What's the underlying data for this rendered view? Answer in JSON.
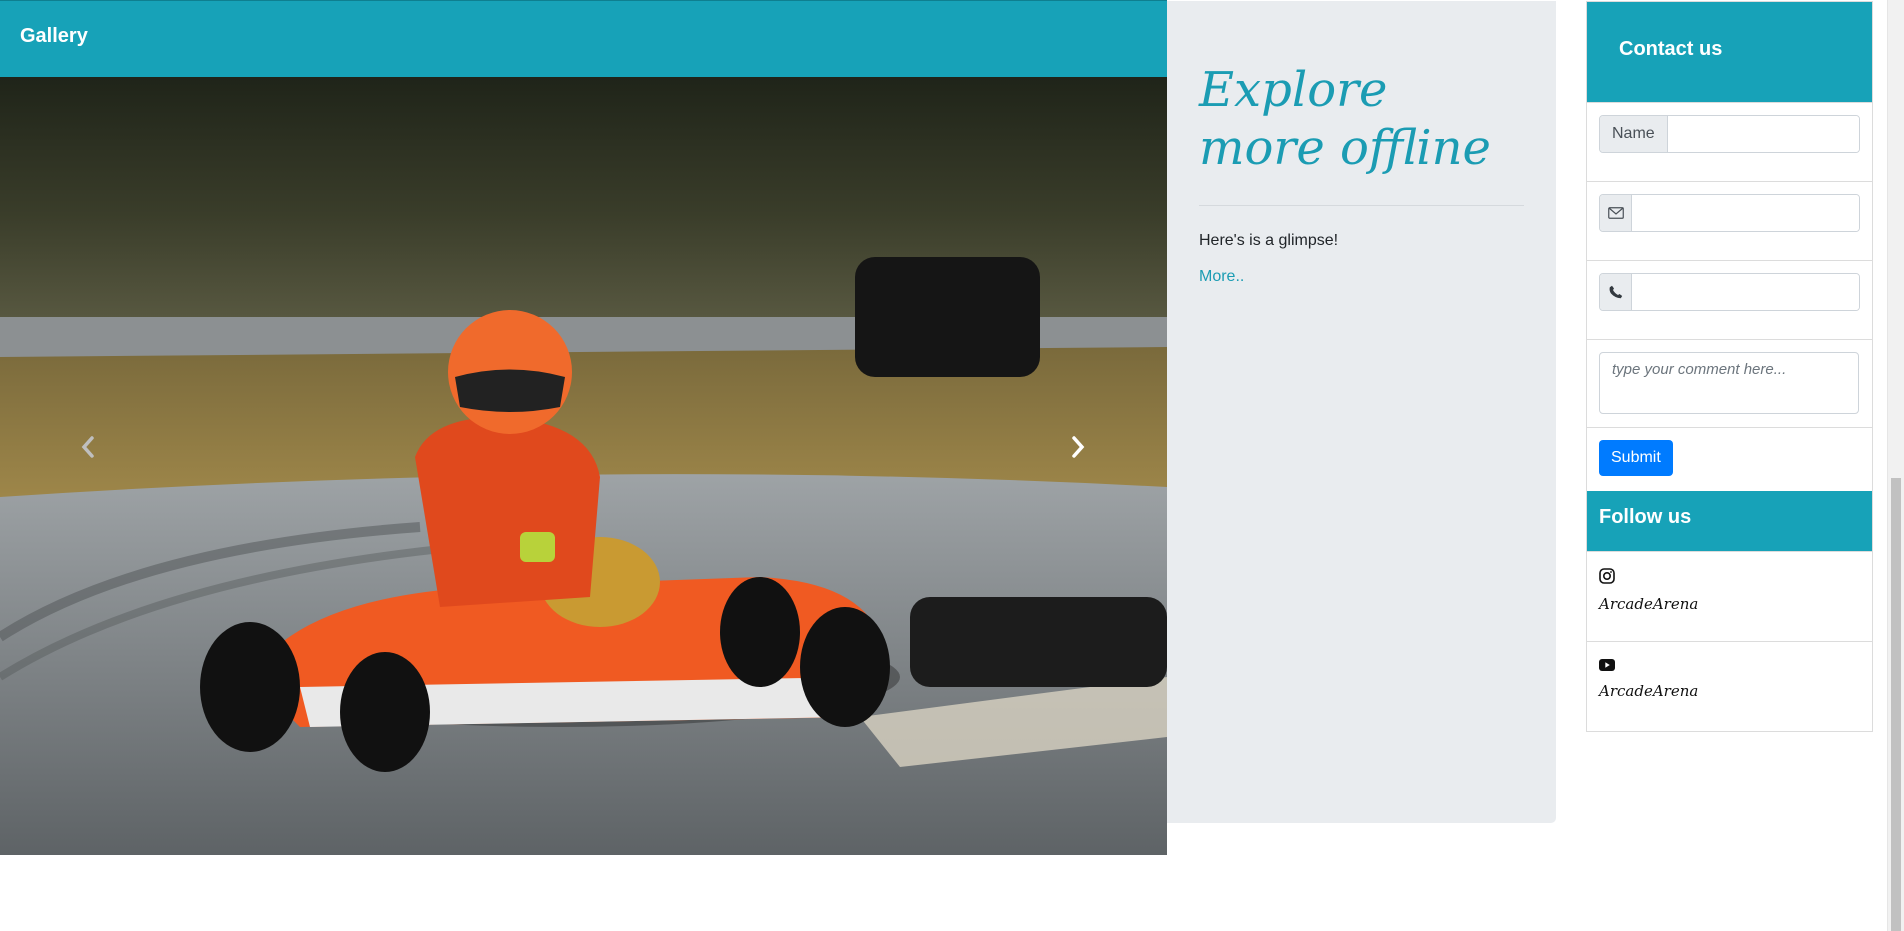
{
  "gallery": {
    "title": "Gallery",
    "prev_icon": "chevron-left-icon",
    "next_icon": "chevron-right-icon",
    "image_description_icon": "karting-photo"
  },
  "explore": {
    "title": "Explore more offline",
    "text": "Here's is a glimpse!",
    "link": "More.."
  },
  "contact": {
    "title": "Contact us",
    "name_label": "Name",
    "email_icon": "envelope-icon",
    "phone_icon": "phone-icon",
    "comment_placeholder": "type your comment here...",
    "submit_label": "Submit"
  },
  "follow": {
    "title": "Follow us",
    "items": [
      {
        "icon": "instagram-icon",
        "label": "ArcadeArena"
      },
      {
        "icon": "youtube-icon",
        "label": "ArcadeArena"
      }
    ]
  },
  "colors": {
    "accent": "#17a2b8",
    "button": "#007bff",
    "panel": "#e9ecef"
  }
}
